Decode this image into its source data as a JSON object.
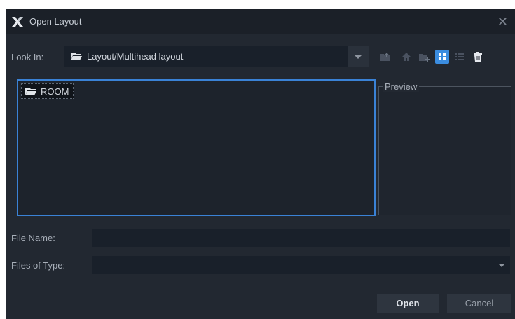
{
  "window": {
    "title": "Open Layout",
    "close_symbol": "✕"
  },
  "lookin": {
    "label": "Look In:",
    "value": "Layout/Multihead layout"
  },
  "toolbar": {
    "icons": [
      "up-folder-icon",
      "home-icon",
      "new-folder-icon",
      "grid-view-icon",
      "list-view-icon",
      "trash-icon"
    ],
    "active": "grid-view-icon",
    "accent": "#3b8de0"
  },
  "filelist": {
    "items": [
      {
        "name": "ROOM",
        "icon": "folder-icon"
      }
    ]
  },
  "preview": {
    "title": "Preview"
  },
  "filename": {
    "label": "File Name:",
    "value": ""
  },
  "filetype": {
    "label": "Files of Type:",
    "value": ""
  },
  "buttons": {
    "open": "Open",
    "cancel": "Cancel"
  }
}
